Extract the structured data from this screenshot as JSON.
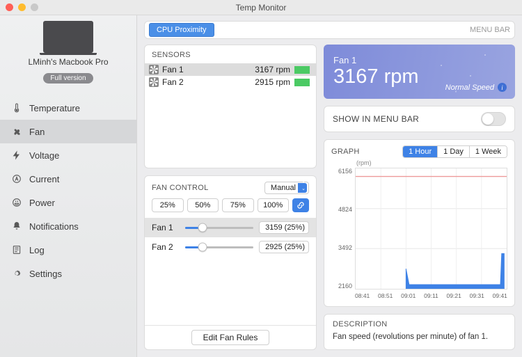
{
  "window": {
    "title": "Temp Monitor"
  },
  "device": {
    "name": "LMinh's Macbook Pro",
    "badge": "Full version"
  },
  "nav": [
    {
      "id": "temperature",
      "label": "Temperature"
    },
    {
      "id": "fan",
      "label": "Fan"
    },
    {
      "id": "voltage",
      "label": "Voltage"
    },
    {
      "id": "current",
      "label": "Current"
    },
    {
      "id": "power",
      "label": "Power"
    },
    {
      "id": "notifications",
      "label": "Notifications"
    },
    {
      "id": "log",
      "label": "Log"
    },
    {
      "id": "settings",
      "label": "Settings"
    }
  ],
  "nav_active": "fan",
  "topbar": {
    "chip": "CPU Proximity",
    "menubar": "MENU BAR"
  },
  "sensors": {
    "title": "SENSORS",
    "rows": [
      {
        "name": "Fan 1",
        "value": "3167 rpm",
        "selected": true
      },
      {
        "name": "Fan 2",
        "value": "2915 rpm",
        "selected": false
      }
    ]
  },
  "fan_control": {
    "title": "FAN CONTROL",
    "mode": "Manual",
    "presets": [
      "25%",
      "50%",
      "75%",
      "100%"
    ],
    "linked": true,
    "rows": [
      {
        "name": "Fan 1",
        "display": "3159 (25%)",
        "pct": 25,
        "selected": true
      },
      {
        "name": "Fan 2",
        "display": "2925 (25%)",
        "pct": 25,
        "selected": false
      }
    ],
    "rules_button": "Edit Fan Rules"
  },
  "hero": {
    "name": "Fan 1",
    "value": "3167 rpm",
    "status": "Normal Speed"
  },
  "menubar_toggle": {
    "label": "SHOW IN MENU BAR",
    "on": false
  },
  "graph": {
    "title": "GRAPH",
    "ranges": [
      "1 Hour",
      "1 Day",
      "1 Week"
    ],
    "active_range": "1 Hour",
    "unit": "(rpm)",
    "yticks": [
      "6156",
      "4824",
      "3492",
      "2160"
    ],
    "xticks": [
      "08:41",
      "08:51",
      "09:01",
      "09:11",
      "09:21",
      "09:31",
      "09:41"
    ]
  },
  "description": {
    "title": "DESCRIPTION",
    "text": "Fan speed (revolutions per minute) of fan 1."
  },
  "colors": {
    "accent": "#3e82e6",
    "green": "#4bca64",
    "hero_a": "#7e8bd9",
    "hero_b": "#99a4e0"
  },
  "chart_data": {
    "type": "line",
    "title": "",
    "xlabel": "",
    "ylabel": "rpm",
    "ylim": [
      2160,
      6156
    ],
    "x": [
      "08:41",
      "08:51",
      "09:01",
      "09:11",
      "09:21",
      "09:31",
      "09:41"
    ],
    "series": [
      {
        "name": "Fan 1",
        "values": [
          null,
          null,
          2300,
          2300,
          2300,
          2300,
          3300
        ]
      }
    ],
    "reference_line": 5900
  }
}
